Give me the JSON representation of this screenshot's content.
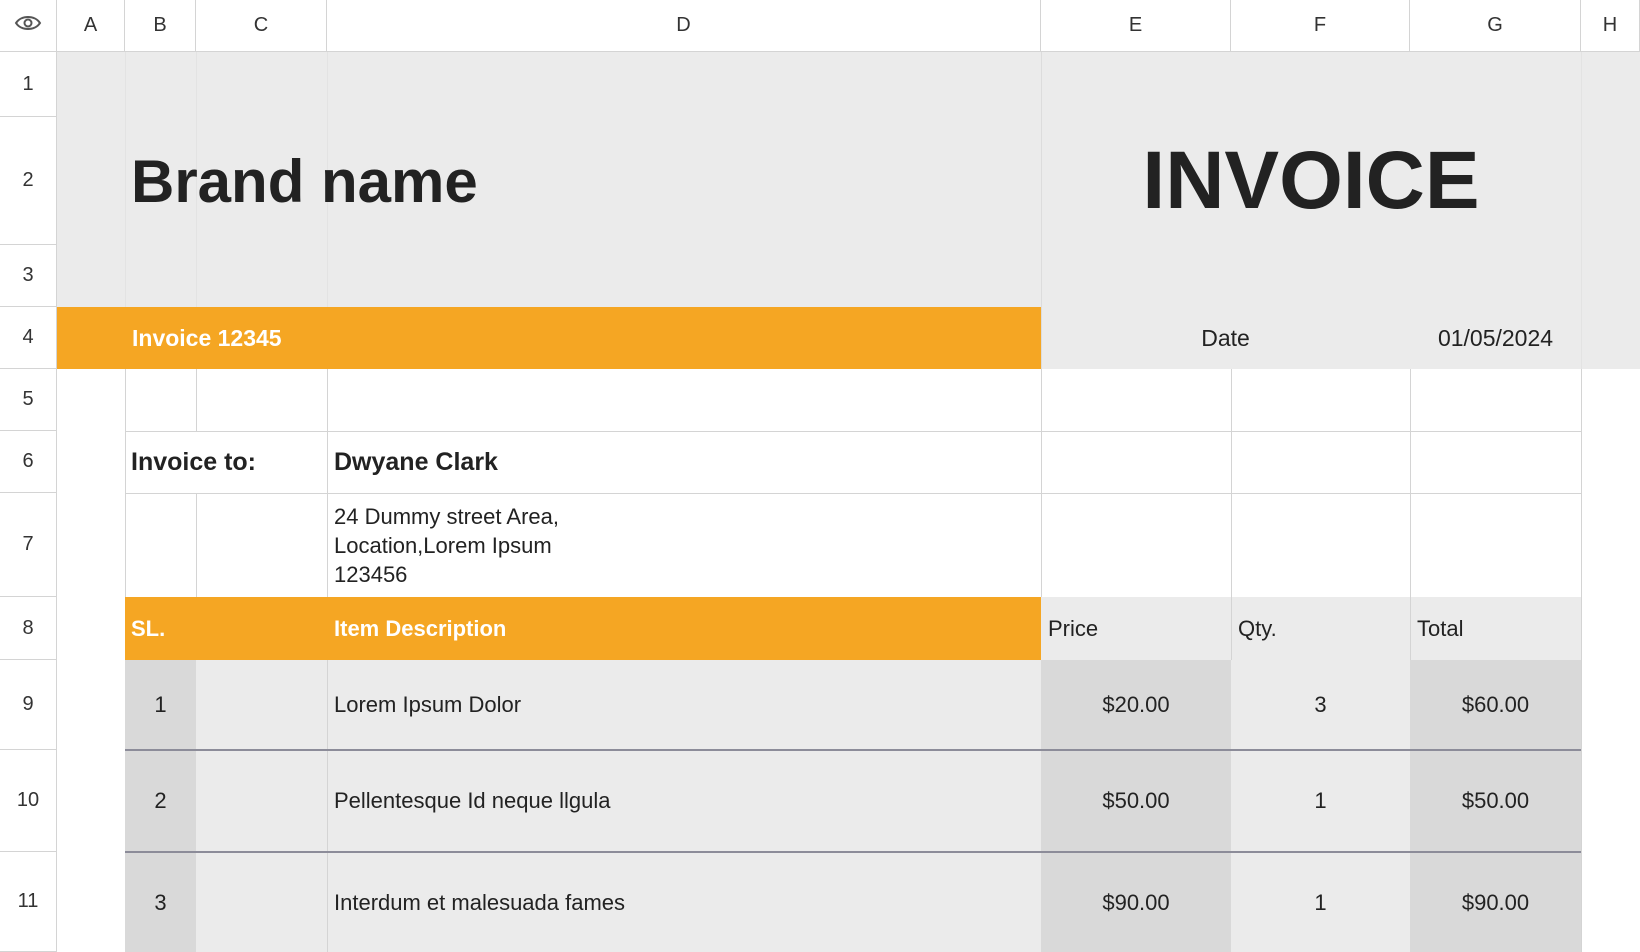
{
  "columns": [
    "A",
    "B",
    "C",
    "D",
    "E",
    "F",
    "G",
    "H"
  ],
  "rows": [
    "1",
    "2",
    "3",
    "4",
    "5",
    "6",
    "7",
    "8",
    "9",
    "10",
    "11"
  ],
  "header": {
    "brand": "Brand name",
    "title": "INVOICE",
    "invoice_number": "Invoice 12345",
    "date_label": "Date",
    "date_value": "01/05/2024"
  },
  "bill_to": {
    "label": "Invoice to:",
    "name": "Dwyane Clark",
    "address": "24 Dummy street Area,\nLocation,Lorem Ipsum\n123456"
  },
  "items_header": {
    "sl": "SL.",
    "description": "Item Description",
    "price": "Price",
    "qty": "Qty.",
    "total": "Total"
  },
  "items": [
    {
      "sl": "1",
      "description": "Lorem Ipsum Dolor",
      "price": "$20.00",
      "qty": "3",
      "total": "$60.00"
    },
    {
      "sl": "2",
      "description": "Pellentesque Id neque llgula",
      "price": "$50.00",
      "qty": "1",
      "total": "$50.00"
    },
    {
      "sl": "3",
      "description": "Interdum et malesuada fames",
      "price": "$90.00",
      "qty": "1",
      "total": "$90.00"
    }
  ],
  "colors": {
    "accent": "#F5A623",
    "header_band": "#EBEBEB",
    "price_col": "#D9D9D9",
    "row_bg": "#EBEBEB",
    "grid": "#D4D4D4"
  },
  "icons": {
    "corner": "eye-icon"
  }
}
